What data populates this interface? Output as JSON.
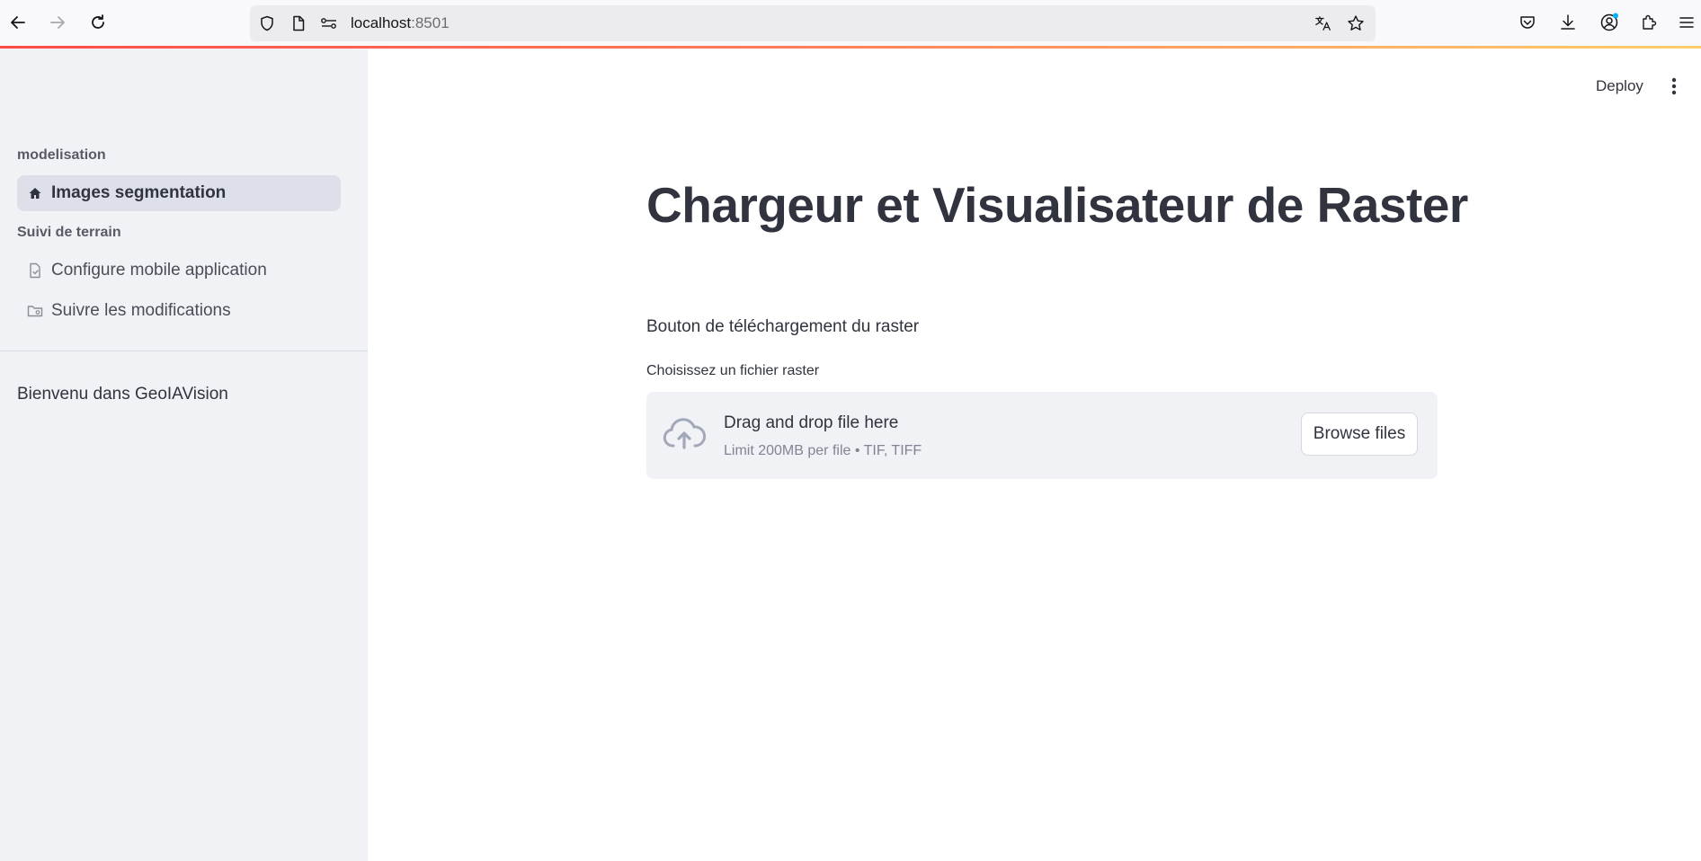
{
  "browser": {
    "url_host": "localhost",
    "url_port": ":8501",
    "icons": {
      "back": "arrow-left-icon",
      "forward": "arrow-right-icon",
      "reload": "reload-icon",
      "shield": "shield-icon",
      "page": "page-icon",
      "permissions": "permissions-icon",
      "translate": "translate-icon",
      "bookmark": "star-icon",
      "pocket": "pocket-icon",
      "downloads": "download-icon",
      "account": "account-icon",
      "extensions": "puzzle-icon",
      "menu": "hamburger-menu-icon"
    },
    "accent_gradient": [
      "#ff4b4b",
      "#ffcf6b"
    ]
  },
  "sidebar": {
    "sections": [
      {
        "header": "modelisation",
        "items": [
          {
            "label": "Images segmentation",
            "icon": "house-icon",
            "active": true
          }
        ]
      },
      {
        "header": "Suivi de terrain",
        "items": [
          {
            "label": "Configure mobile application",
            "icon": "document-icon",
            "active": false
          },
          {
            "label": "Suivre les modifications",
            "icon": "folder-icon",
            "active": false
          }
        ]
      }
    ],
    "welcome": "Bienvenu dans GeoIAVision"
  },
  "header": {
    "deploy_label": "Deploy",
    "menu_icon": "kebab-menu-icon"
  },
  "main": {
    "title": "Chargeur et Visualisateur de Raster",
    "subheader": "Bouton de téléchargement du raster",
    "uploader": {
      "label": "Choisissez un fichier raster",
      "drop_text": "Drag and drop file here",
      "limit_text": "Limit 200MB per file • TIF, TIFF",
      "browse_label": "Browse files",
      "icon": "cloud-upload-icon"
    }
  },
  "colors": {
    "sidebar_bg": "#f0f2f6",
    "active_item_bg": "#dde0e8",
    "text": "#31333f",
    "muted_text": "#808495"
  }
}
